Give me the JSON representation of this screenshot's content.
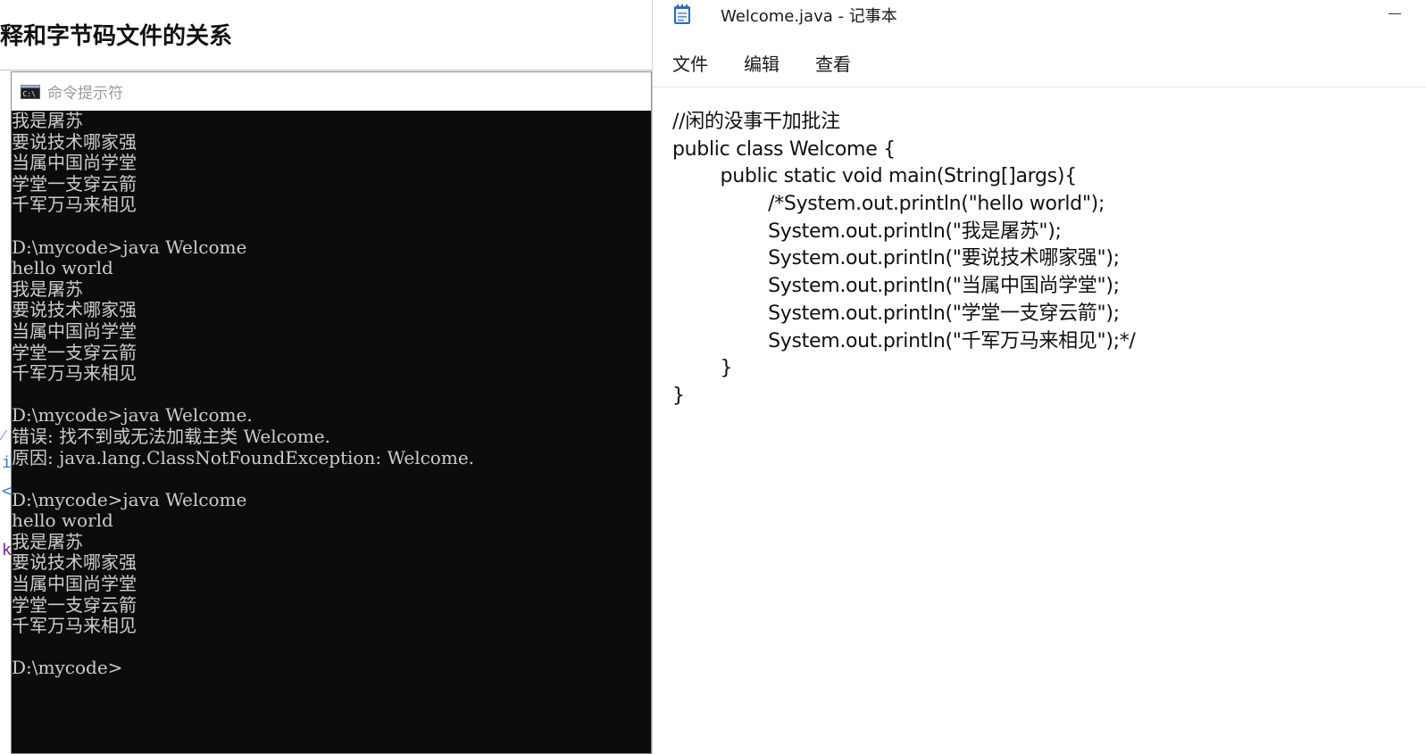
{
  "background_document": {
    "title": "释和字节码文件的关系",
    "fragments": [
      "⁄",
      "i",
      "<",
      "k"
    ]
  },
  "cmd_window": {
    "title": "命令提示符",
    "icon": "terminal-icon",
    "background_color": "#0c0c0c",
    "text_color": "#cccccc",
    "lines": [
      "我是屠苏",
      "要说技术哪家强",
      "当属中国尚学堂",
      "学堂一支穿云箭",
      "千军万马来相见",
      "",
      "D:\\mycode>java Welcome",
      "hello world",
      "我是屠苏",
      "要说技术哪家强",
      "当属中国尚学堂",
      "学堂一支穿云箭",
      "千军万马来相见",
      "",
      "D:\\mycode>java Welcome.",
      "错误: 找不到或无法加载主类 Welcome.",
      "原因: java.lang.ClassNotFoundException: Welcome.",
      "",
      "D:\\mycode>java Welcome",
      "hello world",
      "我是屠苏",
      "要说技术哪家强",
      "当属中国尚学堂",
      "学堂一支穿云箭",
      "千军万马来相见",
      "",
      "D:\\mycode>"
    ]
  },
  "notepad": {
    "title": "Welcome.java - 记事本",
    "icon": "notepad-icon",
    "menu": [
      "文件",
      "编辑",
      "查看"
    ],
    "content_lines": [
      "//闲的没事干加批注",
      "public class Welcome {",
      "        public static void main(String[]args){",
      "                /*System.out.println(\"hello world\");",
      "                System.out.println(\"我是屠苏\");",
      "                System.out.println(\"要说技术哪家强\");",
      "                System.out.println(\"当属中国尚学堂\");",
      "                System.out.println(\"学堂一支穿云箭\");",
      "                System.out.println(\"千军万马来相见\");*/",
      "        }",
      "}"
    ]
  }
}
